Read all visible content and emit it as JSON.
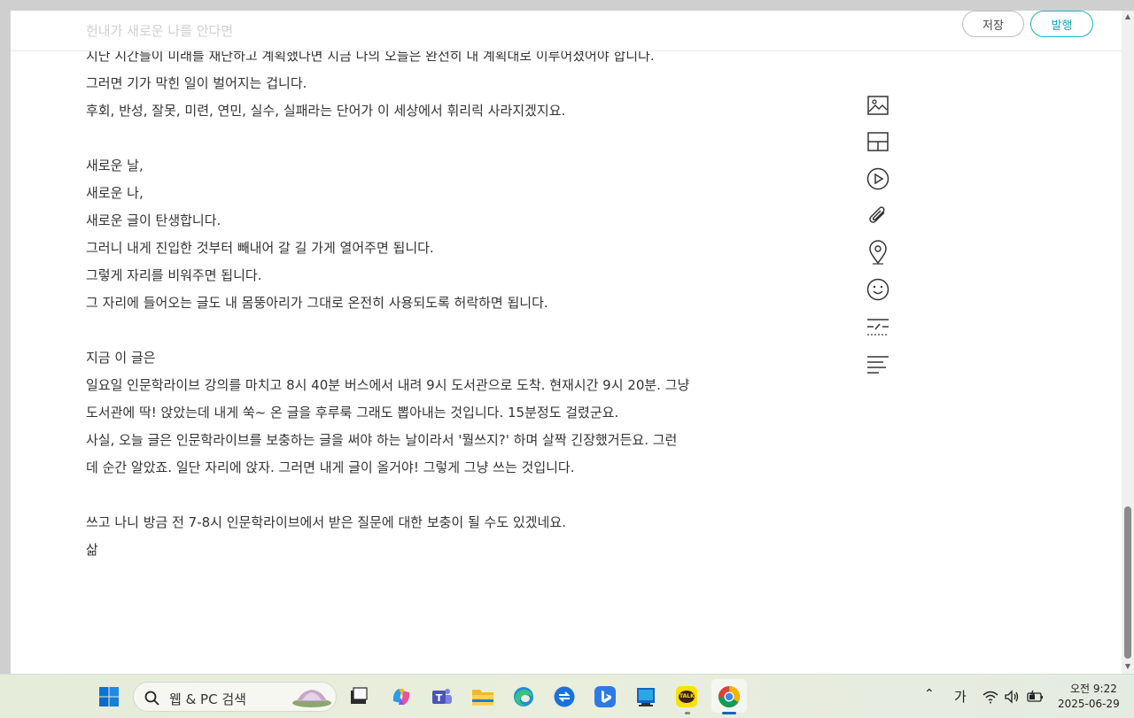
{
  "header": {
    "faded_line": "헌내가 새로운 나를 안다면",
    "save_label": "저장",
    "publish_label": "발행"
  },
  "content": {
    "lines": [
      "지난 시간들이 미래를 재단하고 계획했다면 지금 나의 오늘은 완전히 내 계획대로 이루어졌어야 합니다.",
      "그러면 기가 막힌 일이 벌어지는 겁니다.",
      "후회, 반성, 잘못, 미련, 연민, 실수, 실패라는 단어가 이 세상에서 휘리릭 사라지겠지요.",
      "",
      "새로운 날,",
      "새로운 나,",
      "새로운 글이 탄생합니다.",
      "그러니 내게 진입한 것부터 빼내어 갈 길 가게 열어주면 됩니다.",
      "그렇게 자리를 비워주면 됩니다.",
      "그 자리에 들어오는 글도 내 몸뚱아리가 그대로 온전히 사용되도록 허락하면 됩니다.",
      "",
      "지금 이 글은",
      "일요일 인문학라이브 강의를 마치고 8시 40분 버스에서 내려 9시 도서관으로 도착. 현재시간 9시 20분. 그냥",
      "도서관에 딱! 앉았는데 내게 쑥~ 온 글을 후루룩 그래도 뽑아내는 것입니다. 15분정도 걸렸군요.",
      "사실, 오늘 글은 인문학라이브를 보충하는 글을 써야 하는 날이라서 '뭘쓰지?' 하며 살짝 긴장했거든요. 그런",
      "데 순간 알았죠. 일단 자리에 앉자. 그러면 내게 글이 올거야! 그렇게 그냥 쓰는 것입니다.",
      "",
      "쓰고 나니 방금 전 7-8시 인문학라이브에서 받은 질문에 대한 보충이 될 수도 있겠네요.",
      "삶"
    ]
  },
  "toolbar": {
    "icons": [
      "image-icon",
      "layout-icon",
      "video-icon",
      "attachment-icon",
      "location-icon",
      "emoji-icon",
      "divider-icon",
      "align-icon"
    ]
  },
  "taskbar": {
    "search_placeholder": "웹 & PC 검색",
    "ime_label": "가",
    "time": "오전 9:22",
    "date": "2025-06-29",
    "apps": [
      "windows-start",
      "task-view",
      "copilot",
      "teams",
      "file-explorer",
      "edge",
      "remote-app",
      "bing",
      "store",
      "kakaotalk",
      "chrome"
    ],
    "kakao_label": "TALK"
  },
  "colors": {
    "accent": "#19b2c1",
    "text": "#333333",
    "taskbar": "#e7edda"
  }
}
